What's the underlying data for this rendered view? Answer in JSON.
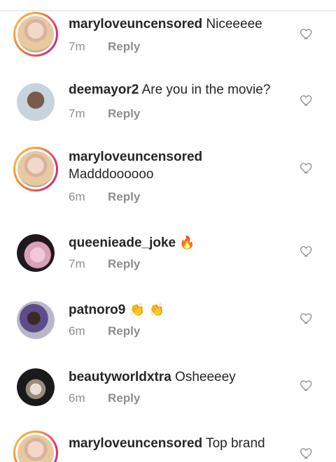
{
  "comments": [
    {
      "username": "maryloveuncensored",
      "text": "Niceeeee",
      "time": "7m",
      "reply": "Reply"
    },
    {
      "username": "deemayor2",
      "text": "Are you in the movie?",
      "time": "7m",
      "reply": "Reply"
    },
    {
      "username": "maryloveuncensored",
      "text": "Madddoooooo",
      "time": "6m",
      "reply": "Reply"
    },
    {
      "username": "queenieade_joke",
      "text": "🔥",
      "time": "7m",
      "reply": "Reply"
    },
    {
      "username": "patnoro9",
      "text": "👏 👏",
      "time": "6m",
      "reply": "Reply"
    },
    {
      "username": "beautyworldxtra",
      "text": "Osheeeey",
      "time": "6m",
      "reply": "Reply"
    },
    {
      "username": "maryloveuncensored",
      "text": "Top brand",
      "time": "",
      "reply": ""
    }
  ],
  "icons": {
    "like": "heart-outline-icon"
  }
}
